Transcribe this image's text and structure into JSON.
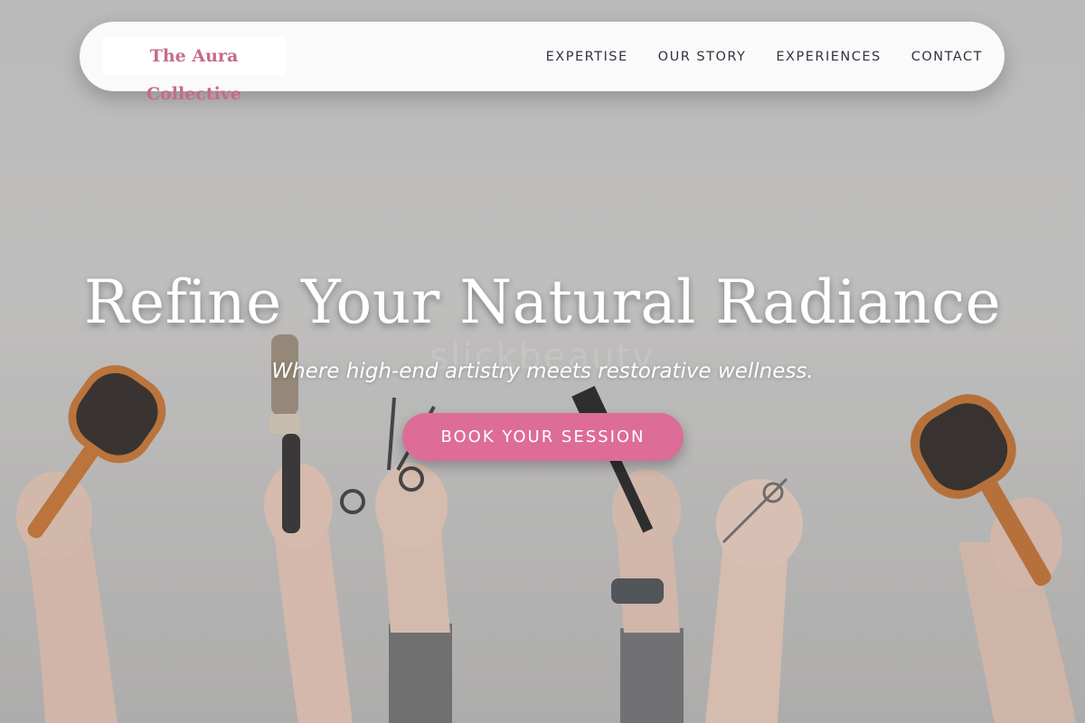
{
  "brand": {
    "name": "The Aura Collective",
    "color": "#c76a8e"
  },
  "nav": {
    "items": [
      "EXPERTISE",
      "OUR STORY",
      "EXPERIENCES",
      "CONTACT"
    ]
  },
  "hero": {
    "title": "Refine Your Natural Radiance",
    "background_watermark": "slickbeauty",
    "subtitle": "Where high-end artistry meets restorative wellness.",
    "cta_label": "BOOK YOUR SESSION",
    "cta_color": "#dd6d96"
  }
}
